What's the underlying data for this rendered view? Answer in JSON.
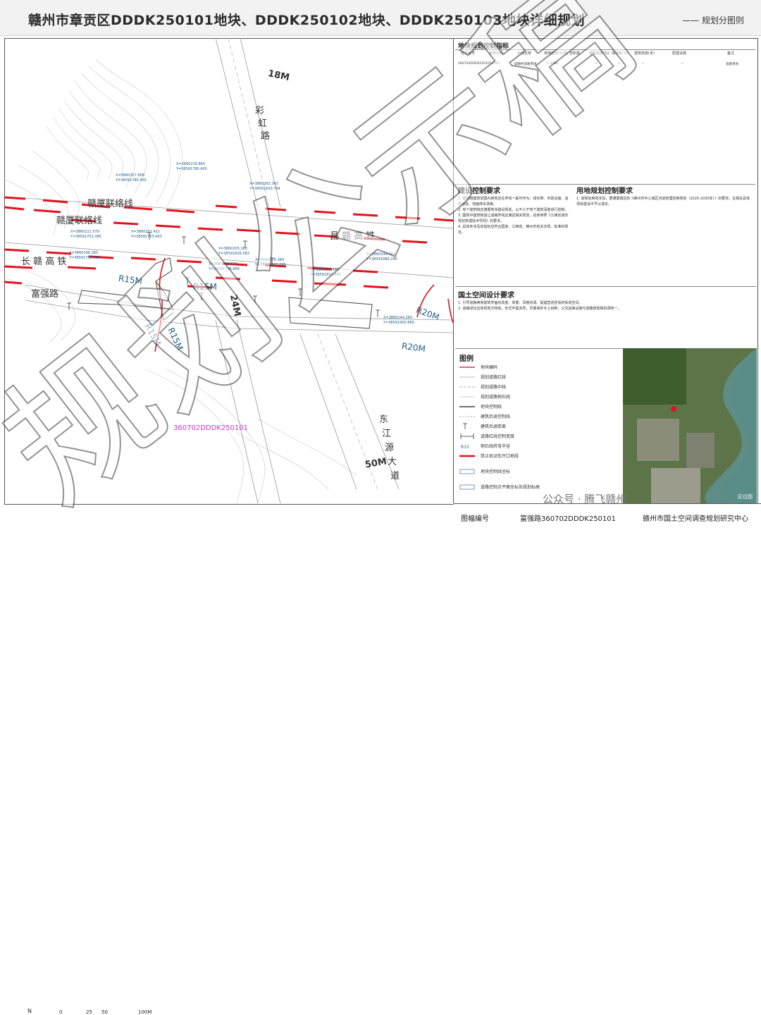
{
  "header": {
    "title": "赣州市章贡区DDDK250101地块、DDDK250102地块、DDDK250103地块详细规划",
    "tag": "—— 规划分图则"
  },
  "map": {
    "roads": {
      "r18m": "18M",
      "caihong1": "彩",
      "caihong2": "虹",
      "caihong3": "路",
      "ganxia1": "赣厦联络线",
      "ganxia2": "赣厦联络线",
      "changgan": "长 赣 高 铁",
      "changgan_chars": [
        "长",
        "赣",
        "高",
        "铁"
      ],
      "fuqiang": "富强路",
      "changgan_hsr": "昌 赣 高 铁",
      "r15m_a": "R15M",
      "r15m_b": "R15M",
      "r15m_c": "R15M",
      "r15m_d": "R15M",
      "r24m": "24M",
      "r20m_a": "R20M",
      "r20m_b": "R20M",
      "dongjiang1": "东",
      "dongjiang2": "江",
      "dongjiang3": "源",
      "dongjiang4": "大",
      "dongjiang5": "道",
      "r50m": "50M"
    },
    "parcel_code": "360702DDDK250101",
    "coords": [
      "X=3860239.860\nY=38591780.405",
      "X=3860257.608\nY=38591780.455",
      "X=3860262.342\nY=38591810.794",
      "X=3860221.579\nY=38591751.385",
      "X=3860201.421\nY=38591753.403",
      "X=3860205.282\nY=38591826.583",
      "X=3860196.183\nY=38591785.586",
      "X=3860217.579\nY=38591796.889",
      "X=3860176.384\nY=38591842.085",
      "X=3860150.499\nY=38591812.890",
      "X=3860144.489\nY=38591889.290",
      "X=3860144.260\nY=38591900.880"
    ],
    "scale": {
      "ticks": [
        "0",
        "25",
        "50",
        "100M"
      ]
    },
    "north": "N"
  },
  "side": {
    "table_title": "地块规划控制指标",
    "table_headers": [
      "地块编号",
      "用地代码",
      "用地名称",
      "用地面积(公顷)",
      "容积率",
      "建筑密度(%)",
      "绿地率(%)",
      "建筑高度(米)",
      "配建设施",
      "备注"
    ],
    "table_row": [
      "360702DDDK250101",
      "1207",
      "城镇村道路用地",
      "5.4965",
      "—",
      "—",
      "—",
      "—",
      "—",
      "道路用地"
    ],
    "build_title": "建设控制要求",
    "build_notes": "1. 建筑物建筑范围内用地应在界线一般可作为：绿化带、市政设施、消防通道、地面停车场等。\n2. 地下建筑物应遵循地块建设规划，以不小于地下建筑深度进行控制。\n3. 图则中建筑物退让道路界线应满足相关规范，具体参照《江西省城市规划管理技术导则》的要求。\n4. 具体未涉及的指标应符合国家、江西省、赣州市有关法规、标准的规定。",
    "land_title": "用地规划控制要求",
    "land_notes": "1. 如规划用地涉及，要遵循相应的《赣州市中心城区河道管理控制规划（2020-2030年）》的要求，在相关具体项目建设中予以落实。",
    "space_title": "国土空间设计要求",
    "space_notes": "1. 引导道路两侧建筑界面的高度、体量、风格协调，提倡营造舒适的街道空间。\n2. 道路绿化应体现地方特色，形式丰富多样，尽量保护乡土树种，公交站等设施与道路景观相协调统一。",
    "legend_title": "图例",
    "legend": [
      "地块编码",
      "规划道路红线",
      "规划道路中线",
      "规划道路侧石线",
      "地块控制线",
      "建筑后退控制线",
      "建筑后退距离",
      "道路红线控制宽度",
      "侧石线转弯半径",
      "禁止机动车开口地段",
      "地块控制线坐标",
      "道路控制点平面坐标及规划标高"
    ],
    "locator_label": "区位图"
  },
  "footer": {
    "label": "图幅编号",
    "sheet_no": "富强路360702DDDK250101",
    "org": "赣州市国土空间调查规划研究中心"
  },
  "watermark": {
    "text": "规划公示稿",
    "wechat": "公众号 · 腾飞赣州"
  },
  "colors": {
    "red_line": "#e1141e",
    "road_label": "#1f5b86",
    "parcel_code": "#c438c9"
  }
}
